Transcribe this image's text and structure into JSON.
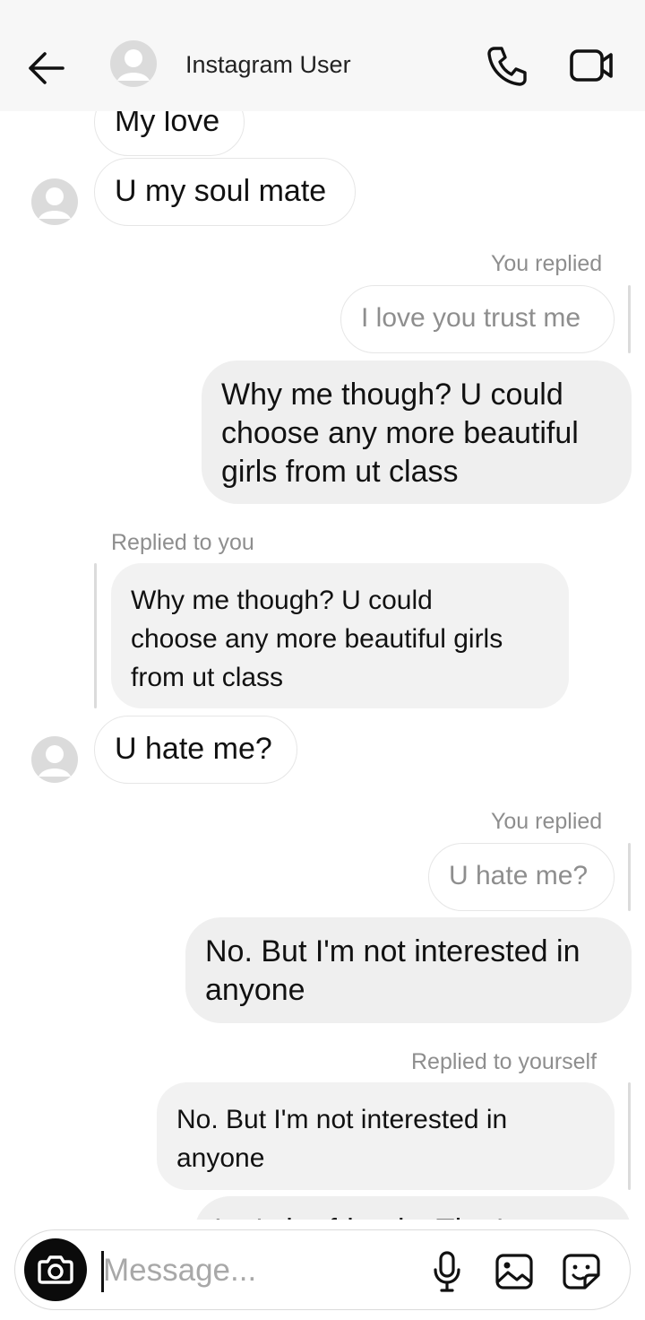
{
  "header": {
    "title": "Instagram User",
    "back_icon": "arrow-left-icon",
    "call_icon": "phone-icon",
    "video_icon": "video-camera-icon"
  },
  "messages": [
    {
      "from": "them",
      "text": "My love"
    },
    {
      "from": "them",
      "text": "U my soul mate"
    },
    {
      "from": "me",
      "meta": "You replied",
      "reply_to": "I love you trust me",
      "lines": [
        "Why me though? U could",
        "choose any more beautiful",
        "girls from ut class"
      ]
    },
    {
      "from": "them",
      "meta": "Replied to you",
      "quote_lines": [
        "Why me though? U could",
        "choose any more beautiful girls",
        "from ut class"
      ],
      "text": "U hate me?"
    },
    {
      "from": "me",
      "meta": "You replied",
      "reply_to": "U hate me?",
      "lines": [
        "No. But I'm not interested in",
        "anyone"
      ]
    },
    {
      "from": "me",
      "meta": "Replied to yourself",
      "quote_lines": [
        "No. But I'm not interested in",
        "anyone"
      ],
      "lines": [
        "Let's be friends. That's way"
      ]
    }
  ],
  "composer": {
    "placeholder": "Message...",
    "camera_icon": "camera-icon",
    "mic_icon": "microphone-icon",
    "gallery_icon": "image-gallery-icon",
    "sticker_icon": "sticker-icon"
  },
  "colors": {
    "header_bg": "#f7f7f7",
    "my_bubble": "#efefef",
    "meta_text": "#8e8e8e",
    "camera_button": "#0b0b0b"
  }
}
